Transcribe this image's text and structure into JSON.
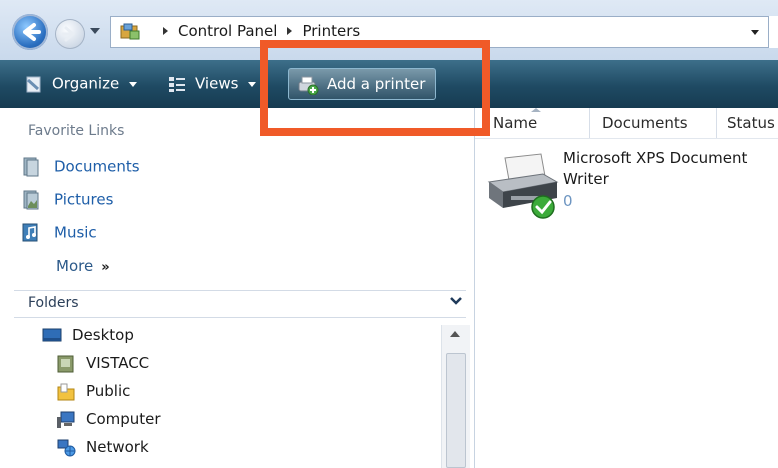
{
  "address_bar": {
    "breadcrumbs": [
      "Control Panel",
      "Printers"
    ]
  },
  "command_bar": {
    "organize_label": "Organize",
    "views_label": "Views",
    "add_printer_label": "Add a printer"
  },
  "nav_pane": {
    "favorite_links_title": "Favorite Links",
    "favorites": [
      {
        "label": "Documents",
        "icon": "documents-icon"
      },
      {
        "label": "Pictures",
        "icon": "pictures-icon"
      },
      {
        "label": "Music",
        "icon": "music-icon"
      }
    ],
    "more_label": "More",
    "more_glyph": "»",
    "folders_title": "Folders",
    "tree": [
      {
        "label": "Desktop",
        "icon": "desktop-icon"
      },
      {
        "label": "VISTACC",
        "icon": "user-folder-icon"
      },
      {
        "label": "Public",
        "icon": "public-folder-icon"
      },
      {
        "label": "Computer",
        "icon": "computer-icon"
      },
      {
        "label": "Network",
        "icon": "network-icon"
      }
    ]
  },
  "content": {
    "columns": [
      "Name",
      "Documents",
      "Status"
    ],
    "printers": [
      {
        "name": "Microsoft XPS Document Writer",
        "documents": "0"
      }
    ]
  },
  "colors": {
    "highlight": "#f05a28",
    "command_bar": "#1f4a63",
    "link": "#1e5ea8"
  }
}
